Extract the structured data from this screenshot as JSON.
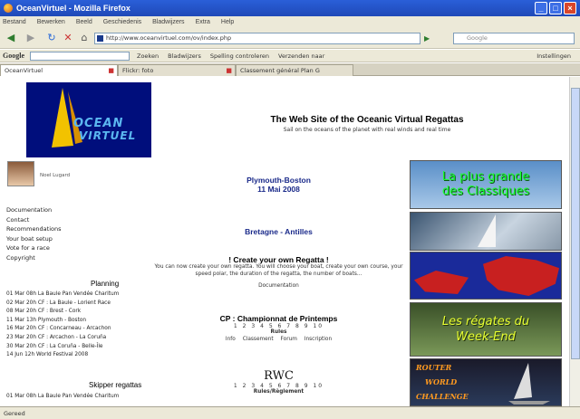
{
  "window": {
    "title": "OceanVirtuel - Mozilla Firefox",
    "controls": [
      "_",
      "□",
      "×"
    ]
  },
  "menu": [
    "Bestand",
    "Bewerken",
    "Beeld",
    "Geschiedenis",
    "Bladwijzers",
    "Extra",
    "Help"
  ],
  "nav": {
    "url": "http://www.oceanvirtuel.com/ov/index.php",
    "search_placeholder": "Google"
  },
  "google_toolbar": {
    "logo": "Google",
    "items": [
      "Zoeken",
      "Bladwijzers",
      "Spelling controleren",
      "Verzenden naar",
      "Instellingen"
    ]
  },
  "tabs": [
    {
      "label": "OceanVirtuel",
      "active": true
    },
    {
      "label": "Flickr: foto",
      "active": false
    },
    {
      "label": "Classement général Plan G",
      "active": false
    }
  ],
  "page": {
    "logo_line1": "OCEAN",
    "logo_line2": "VIRTUEL",
    "site_title": "The Web Site of the Oceanic Virtual Regattas",
    "site_subtitle": "Sail on the oceans of the planet with real winds and real time",
    "user_name": "Noel Lugard",
    "left_links": [
      "Documentation",
      "Contact",
      "Recommendations",
      "Your boat setup",
      "Vote for a race",
      "Copyright"
    ],
    "planning_heading": "Planning",
    "planning": [
      "01 Mar 08h  La Baule Pan Vendée Charitum",
      "02 Mar 20h  CF : La Baule - Lorient Race",
      "08 Mar 20h  CF : Brest - Cork",
      "11 Mar 13h  Plymouth - Boston",
      "16 Mar 20h  CF : Concarneau - Arcachon",
      "23 Mar 20h  CF : Arcachon - La Coruña",
      "30 Mar 20h  CF : La Coruña - Belle-Île",
      "14 Jun 12h  World Festival 2008"
    ],
    "skipper_heading": "Skipper regattas",
    "skipper": [
      "01 Mar 08h  La Baule Pan Vendée Charitum"
    ],
    "race1_name": "Plymouth-Boston",
    "race1_date": "11 Mai 2008",
    "race2_name": "Bretagne - Antilles",
    "create_title": "! Create your own Regatta !",
    "create_text": "You can now create your own regatta. You will choose your boat, create your own course, your speed polar, the duration of the regatta, the number of boats...",
    "documentation": "Documentation",
    "cp_title": "CP : Championnat de Printemps",
    "cp_pages": "1 2 3 4 5 6 7 8 9 10",
    "cp_rules": "Rules",
    "cp_links": [
      "Info",
      "Classement",
      "Forum",
      "Inscription"
    ],
    "rwc_title": "RWC",
    "rwc_pages": "1 2 3 4 5 6 7 8 9 10",
    "rwc_rules": "Rules/Règlement"
  },
  "banners": {
    "b1_line1": "La plus grande",
    "b1_line2": "des Classiques",
    "b4_line1": "Les régates du",
    "b4_line2": "Week-End",
    "b5_line1": "ROUTER",
    "b5_line2": "WORLD",
    "b5_line3": "CHALLENGE"
  },
  "status": {
    "text": "Gereed"
  }
}
